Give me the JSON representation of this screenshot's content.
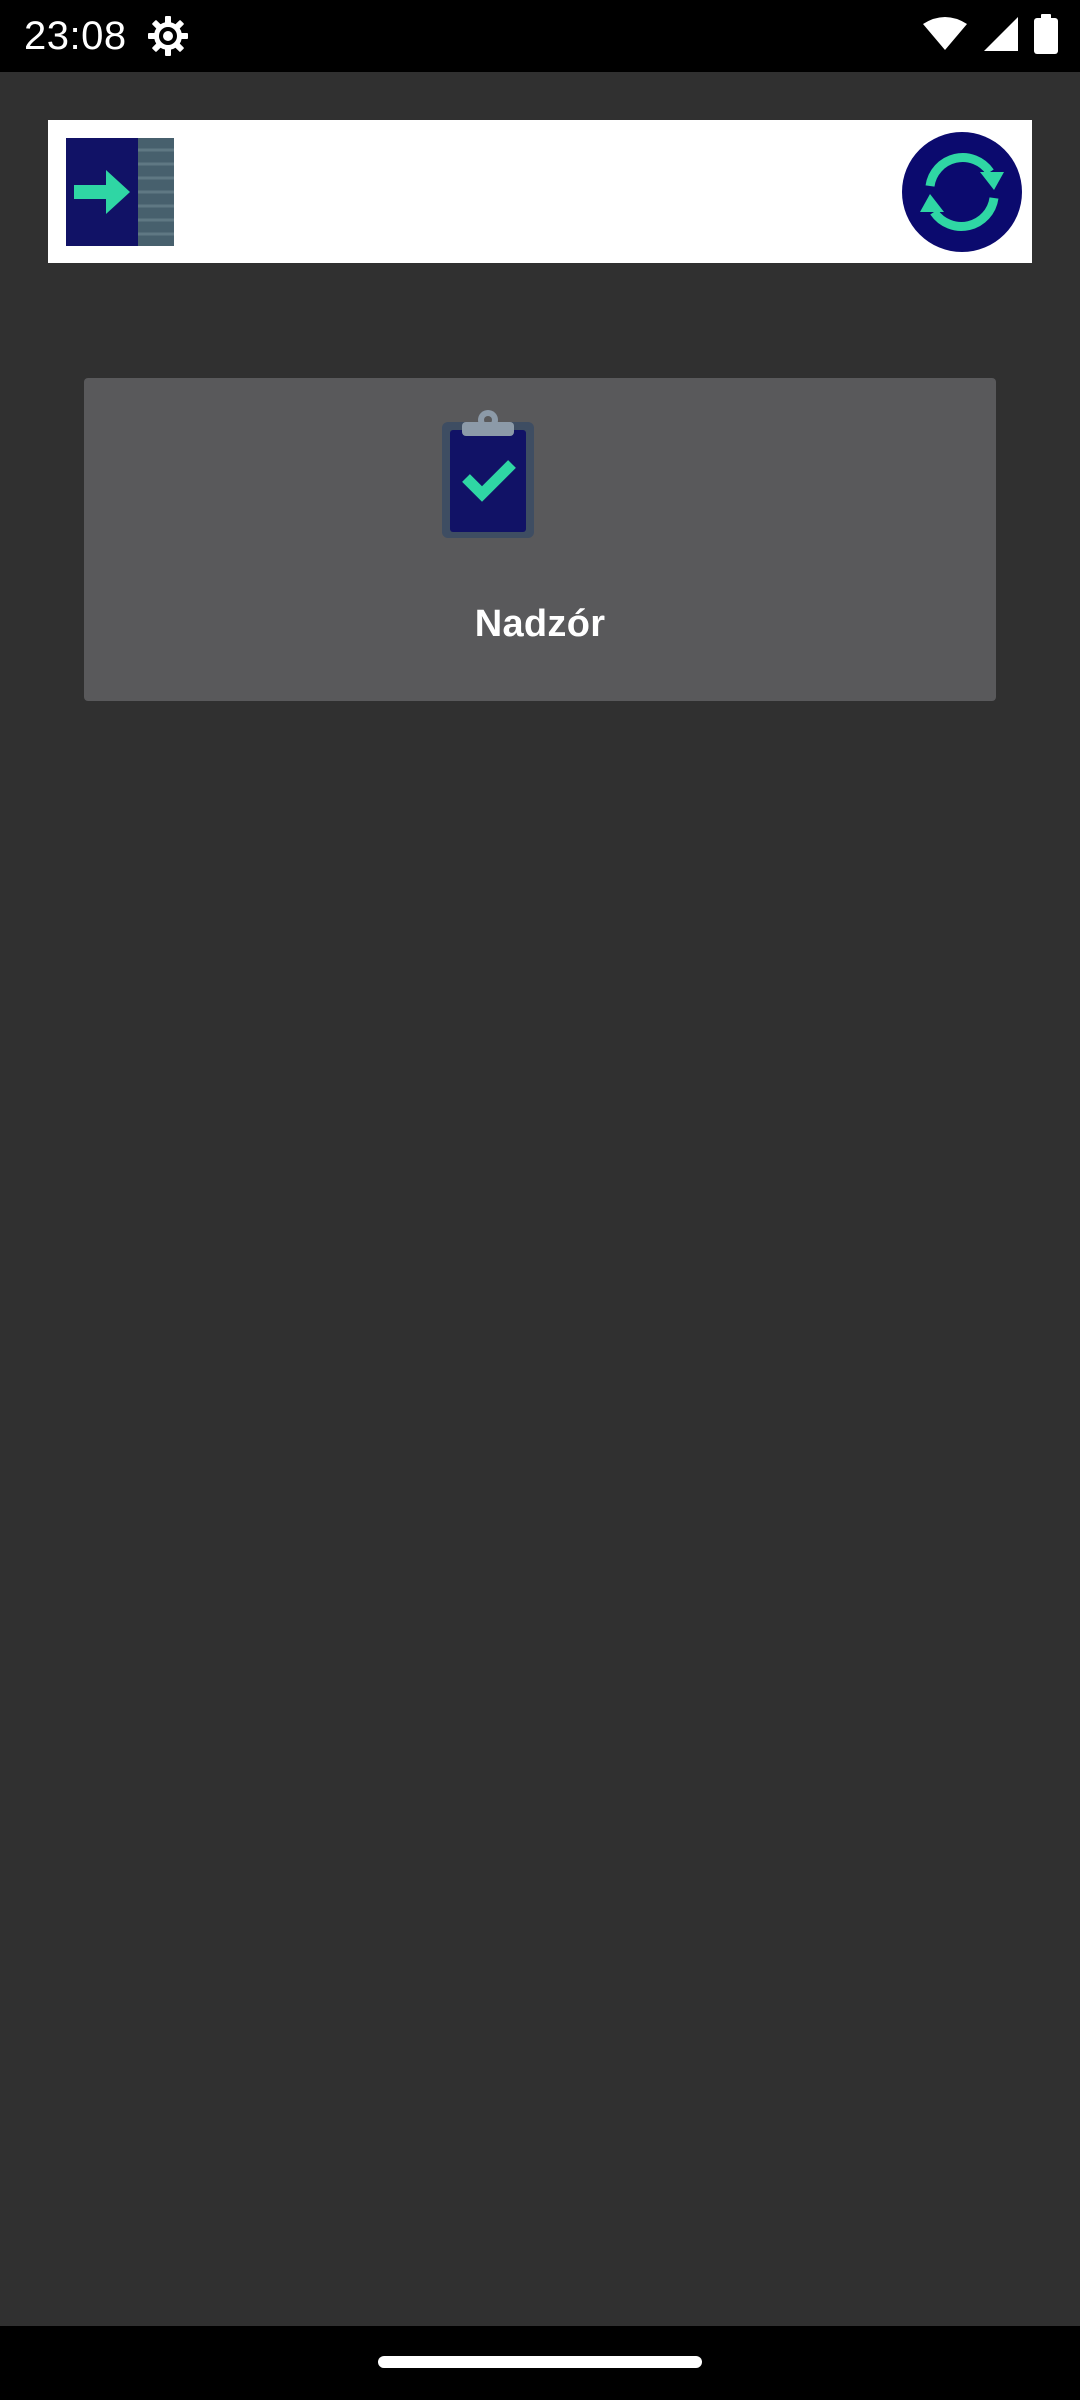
{
  "status_bar": {
    "time": "23:08",
    "icons": [
      "settings-gear-icon",
      "wifi-icon",
      "cellular-signal-icon",
      "battery-icon"
    ]
  },
  "app_bar": {
    "logo_icon": "login-arrow-logo-icon",
    "sync_icon": "sync-icon"
  },
  "tiles": [
    {
      "label": "Nadzór",
      "icon": "clipboard-check-icon"
    }
  ],
  "colors": {
    "background": "#303030",
    "tile": "#59595b",
    "app_bar": "#ffffff",
    "accent_navy": "#0b0a6e",
    "accent_teal": "#2fd6a4"
  }
}
